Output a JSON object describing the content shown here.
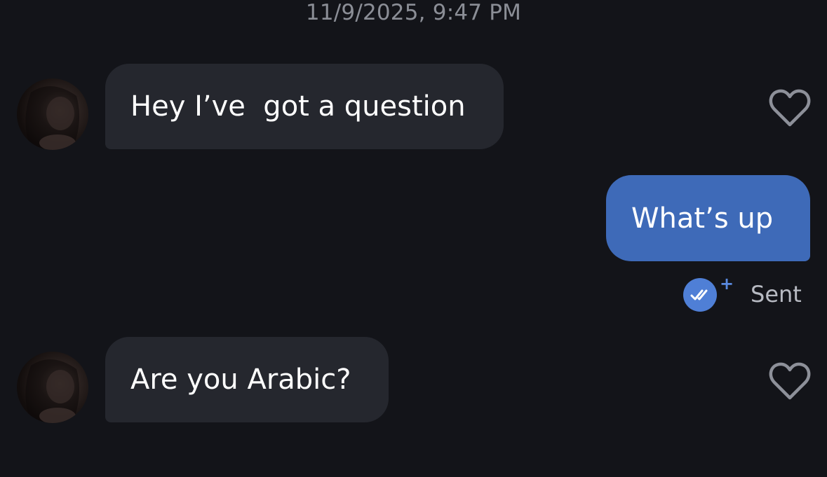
{
  "header": {
    "timestamp": "11/9/2025, 9:47 PM"
  },
  "messages": [
    {
      "direction": "incoming",
      "text": "Hey I’ve  got a question",
      "avatar": "contact-avatar",
      "reaction_icon": "heart-outline-icon"
    },
    {
      "direction": "outgoing",
      "text": "What’s up",
      "status": {
        "icon": "double-check-icon",
        "badge": "+",
        "label": "Sent"
      }
    },
    {
      "direction": "incoming",
      "text": "Are you Arabic?",
      "avatar": "contact-avatar",
      "reaction_icon": "heart-outline-icon"
    }
  ],
  "colors": {
    "background": "#131419",
    "incoming_bubble": "#25272e",
    "outgoing_bubble": "#3e6ab8",
    "timestamp_text": "#8b8e96",
    "status_text": "#b7bac2",
    "receipt_badge": "#4f7fd6",
    "heart_outline": "#8d9099"
  }
}
